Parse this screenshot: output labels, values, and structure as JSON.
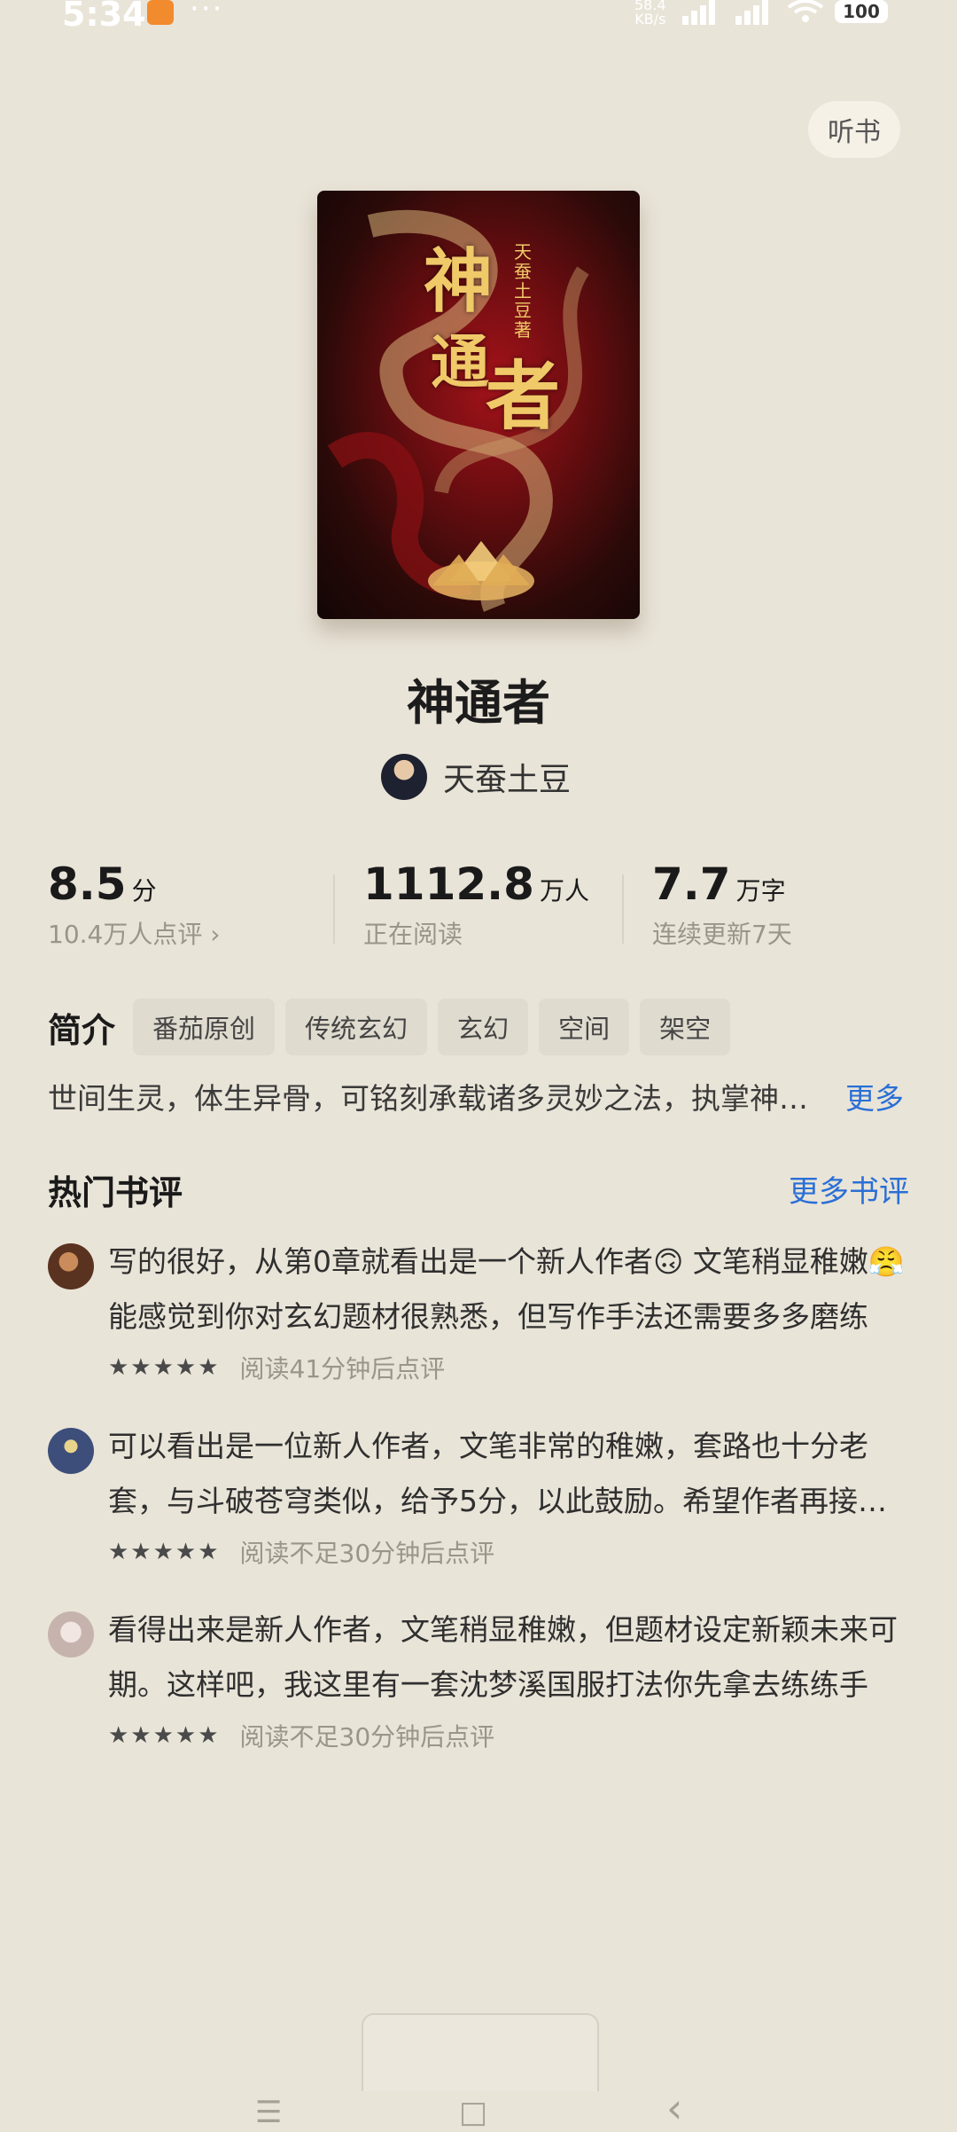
{
  "status_bar": {
    "time": "5:34",
    "net_speed": "58.4",
    "net_unit": "KB/s",
    "battery": "100",
    "icons": [
      "app-notification-icon",
      "more-dots-icon",
      "signal-5g-icon",
      "wifi-icon",
      "battery-icon"
    ]
  },
  "header": {
    "listen_label": "听书"
  },
  "cover": {
    "title_chars": [
      "神",
      "通",
      "者"
    ],
    "author_text": "天蚕土豆著"
  },
  "book": {
    "title": "神通者",
    "author": "天蚕土豆"
  },
  "stats": [
    {
      "value": "8.5",
      "unit": "分",
      "sub": "10.4万人点评 ›"
    },
    {
      "value": "1112.8",
      "unit": "万人",
      "sub": "正在阅读"
    },
    {
      "value": "7.7",
      "unit": "万字",
      "sub": "连续更新7天"
    }
  ],
  "intro": {
    "label": "简介",
    "tags": [
      "番茄原创",
      "传统玄幻",
      "玄幻",
      "空间",
      "架空"
    ],
    "text": "世间生灵，体生异骨，可铭刻承载诸多灵妙之法，执掌神通……",
    "more_label": "更多"
  },
  "reviews": {
    "title": "热门书评",
    "more_label": "更多书评",
    "items": [
      {
        "text": "写的很好，从第0章就看出是一个新人作者🙃 文笔稍显稚嫩😤能感觉到你对玄幻题材很熟悉，但写作手法还需要多多磨练",
        "stars": "★★★★★",
        "note": "阅读41分钟后点评"
      },
      {
        "text": "可以看出是一位新人作者，文笔非常的稚嫩，套路也十分老套，与斗破苍穹类似，给予5分，以此鼓励。希望作者再接再厉",
        "stars": "★★★★★",
        "note": "阅读不足30分钟后点评"
      },
      {
        "text": "看得出来是新人作者，文笔稍显稚嫩，但题材设定新颖未来可期。这样吧，我这里有一套沈梦溪国服打法你先拿去练练手",
        "stars": "★★★★★",
        "note": "阅读不足30分钟后点评"
      }
    ]
  },
  "nav": {
    "menu": "☰",
    "home": "□",
    "back": "‹"
  },
  "colors": {
    "accent": "#2a6fd6",
    "background": "#e9e4d8"
  }
}
